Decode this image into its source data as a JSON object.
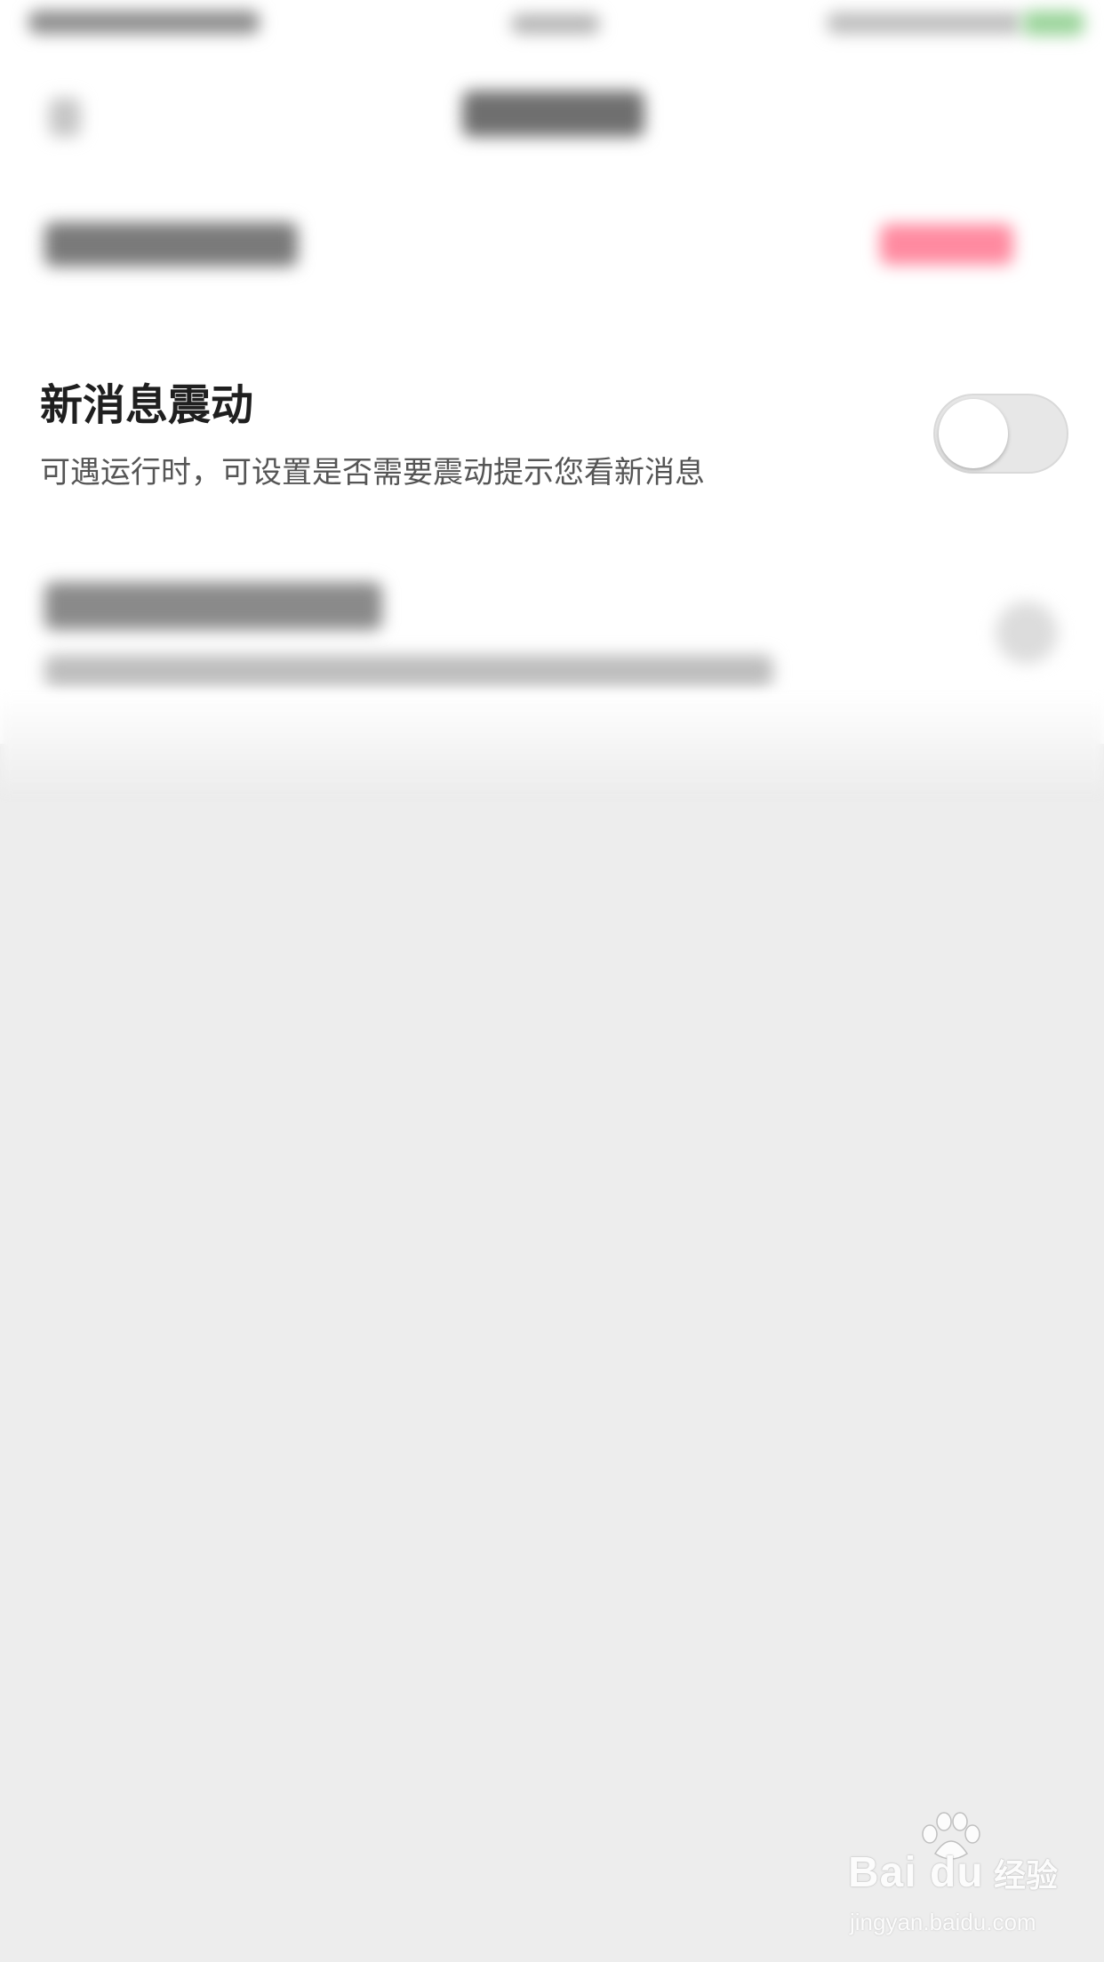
{
  "setting": {
    "title": "新消息震动",
    "description": "可遇运行时，可设置是否需要震动提示您看新消息",
    "toggle_on": false
  },
  "watermark": {
    "brand": "Bai du",
    "brand_cn": "经验",
    "url": "jingyan.baidu.com"
  },
  "colors": {
    "background": "#ededed",
    "row_background": "#ffffff",
    "toggle_off": "#e7e7e7",
    "blurred_accent_red": "#ff8aa0",
    "blurred_battery_green": "#9ad49a"
  },
  "icons": {
    "watermark_logo": "baidu-paw-icon"
  }
}
